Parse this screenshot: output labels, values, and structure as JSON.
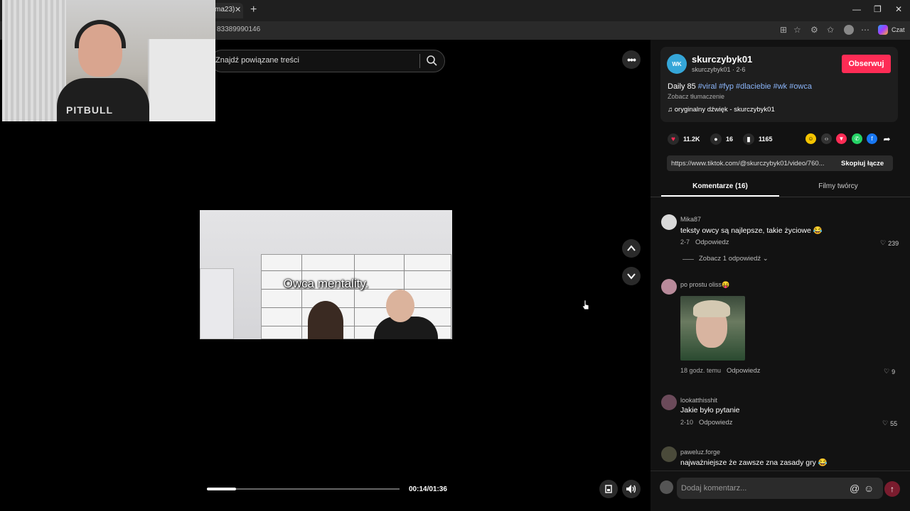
{
  "browser": {
    "tab_label": "ma23)",
    "tab_close": "✕",
    "new_tab": "+",
    "url": "83389990146",
    "czat_label": "Czat"
  },
  "webcam": {
    "shirt_text": "PITBULL"
  },
  "search": {
    "placeholder_text": "Znajdź powiązane treści"
  },
  "video": {
    "subtitle": "Owca mentality.",
    "time": "00:14/01:36",
    "progress_fraction": 0.15
  },
  "creator": {
    "avatar_text": "WK",
    "username": "skurczybyk01",
    "subline": "skurczybyk01 · 2-6",
    "follow_label": "Obserwuj",
    "desc_prefix": "Daily 85 ",
    "hashtags": "#viral #fyp #dlaciebie #wk #owca",
    "translate": "Zobacz tłumaczenie",
    "sound": "oryginalny dźwięk - skurczybyk01"
  },
  "stats": {
    "likes": "11.2K",
    "comments": "16",
    "saves": "1165"
  },
  "share": {
    "link": "https://www.tiktok.com/@skurczybyk01/video/760...",
    "copy_label": "Skopiuj łącze"
  },
  "tabs": {
    "comments": "Komentarze (16)",
    "videos": "Filmy twórcy"
  },
  "comments": [
    {
      "name": "Mika87",
      "text": "teksty owcy są najlepsze, takie życiowe 😂",
      "date": "2-7",
      "reply": "Odpowiedz",
      "likes": "239"
    },
    {
      "name": "po prostu oliss😝",
      "text": "",
      "date": "18 godz. temu",
      "reply": "Odpowiedz",
      "likes": "9"
    },
    {
      "name": "lookatthisshit",
      "text": "Jakie było pytanie",
      "date": "2-10",
      "reply": "Odpowiedz",
      "likes": "55"
    },
    {
      "name": "paweluz.forge",
      "text": "najważniejsze że zawsze zna zasady gry 😂",
      "date": "",
      "reply": "",
      "likes": ""
    }
  ],
  "replies_link": "Zobacz 1 odpowiedź ⌄",
  "comment_bar": {
    "placeholder": "Dodaj komentarz...",
    "at": "@",
    "emoji": "☺",
    "send": "↑"
  },
  "colors": {
    "accent": "#fe2c55",
    "hashtag": "#8ab4f8",
    "panel": "#121212"
  }
}
